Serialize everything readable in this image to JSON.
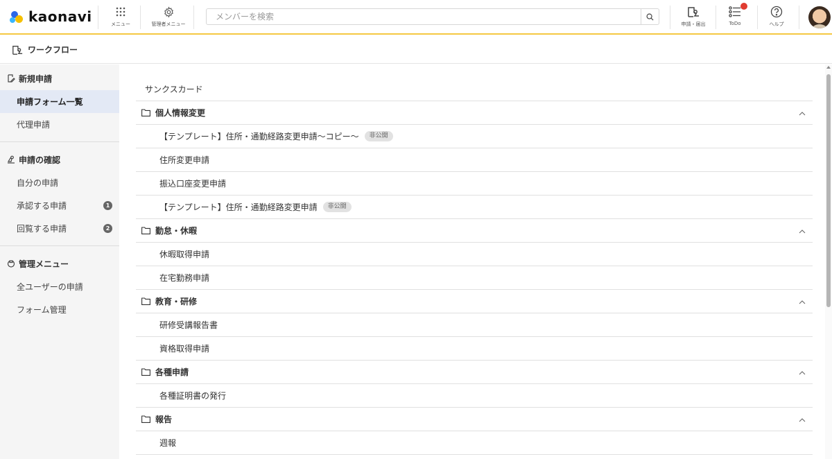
{
  "header": {
    "logo_text": "kaonavi",
    "menu_label": "メニュー",
    "admin_menu_label": "管理者メニュー",
    "search_placeholder": "メンバーを検索",
    "apply_label": "申請・届出",
    "todo_label": "ToDo",
    "help_label": "ヘルプ",
    "todo_has_notification": true
  },
  "subheader": {
    "title": "ワークフロー"
  },
  "sidebar": {
    "sections": [
      {
        "title": "新規申請",
        "icon": "edit-form-icon",
        "items": [
          {
            "label": "申請フォーム一覧",
            "active": true
          },
          {
            "label": "代理申請"
          }
        ]
      },
      {
        "title": "申請の確認",
        "icon": "stamp-icon",
        "items": [
          {
            "label": "自分の申請"
          },
          {
            "label": "承認する申請",
            "badge": "1"
          },
          {
            "label": "回覧する申請",
            "badge": "2"
          }
        ]
      },
      {
        "title": "管理メニュー",
        "icon": "admin-gear-icon",
        "items": [
          {
            "label": "全ユーザーの申請"
          },
          {
            "label": "フォーム管理"
          }
        ]
      }
    ]
  },
  "main": {
    "top_item": "サンクスカード",
    "groups": [
      {
        "title": "個人情報変更",
        "expanded": true,
        "items": [
          {
            "label": "【テンプレート】住所・通勤経路変更申請〜コピー〜",
            "tag": "非公開"
          },
          {
            "label": "住所変更申請"
          },
          {
            "label": "振込口座変更申請"
          },
          {
            "label": "【テンプレート】住所・通勤経路変更申請",
            "tag": "非公開"
          }
        ]
      },
      {
        "title": "勤怠・休暇",
        "expanded": true,
        "items": [
          {
            "label": "休暇取得申請"
          },
          {
            "label": "在宅勤務申請"
          }
        ]
      },
      {
        "title": "教育・研修",
        "expanded": true,
        "items": [
          {
            "label": "研修受講報告書"
          },
          {
            "label": "資格取得申請"
          }
        ]
      },
      {
        "title": "各種申請",
        "expanded": true,
        "items": [
          {
            "label": "各種証明書の発行"
          }
        ]
      },
      {
        "title": "報告",
        "expanded": true,
        "items": [
          {
            "label": "週報"
          }
        ]
      }
    ]
  },
  "colors": {
    "accent_underline": "#f5c842",
    "active_bg": "#e3e9f5",
    "notification": "#e03c31"
  }
}
